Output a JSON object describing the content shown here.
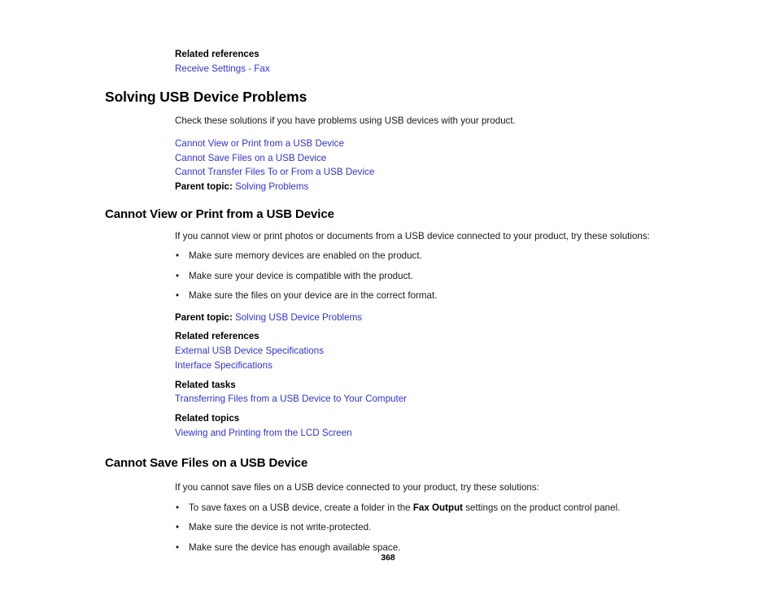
{
  "document": {
    "page_number": "368",
    "link_color": "#3333cc",
    "text_color": "#1a1a1a"
  },
  "top_related": {
    "label": "Related references",
    "links": [
      "Receive Settings - Fax"
    ]
  },
  "section_main": {
    "heading": "Solving USB Device Problems",
    "intro": "Check these solutions if you have problems using USB devices with your product.",
    "child_links": [
      "Cannot View or Print from a USB Device",
      "Cannot Save Files on a USB Device",
      "Cannot Transfer Files To or From a USB Device"
    ],
    "parent_topic": {
      "label": "Parent topic:",
      "link": "Solving Problems"
    }
  },
  "section_view_print": {
    "heading": "Cannot View or Print from a USB Device",
    "intro": "If you cannot view or print photos or documents from a USB device connected to your product, try these solutions:",
    "bullets": [
      "Make sure memory devices are enabled on the product.",
      "Make sure your device is compatible with the product.",
      "Make sure the files on your device are in the correct format."
    ],
    "parent_topic": {
      "label": "Parent topic:",
      "link": "Solving USB Device Problems"
    },
    "related_references": {
      "label": "Related references",
      "links": [
        "External USB Device Specifications",
        "Interface Specifications"
      ]
    },
    "related_tasks": {
      "label": "Related tasks",
      "links": [
        "Transferring Files from a USB Device to Your Computer"
      ]
    },
    "related_topics": {
      "label": "Related topics",
      "links": [
        "Viewing and Printing from the LCD Screen"
      ]
    }
  },
  "section_save_files": {
    "heading": "Cannot Save Files on a USB Device",
    "intro": "If you cannot save files on a USB device connected to your product, try these solutions:",
    "bullets": [
      {
        "pre": "To save faxes on a USB device, create a folder in the ",
        "bold": "Fax Output",
        "post": " settings on the product control panel."
      },
      {
        "pre": "Make sure the device is not write-protected.",
        "bold": "",
        "post": ""
      },
      {
        "pre": "Make sure the device has enough available space.",
        "bold": "",
        "post": ""
      }
    ]
  },
  "bullet_glyph": "•"
}
